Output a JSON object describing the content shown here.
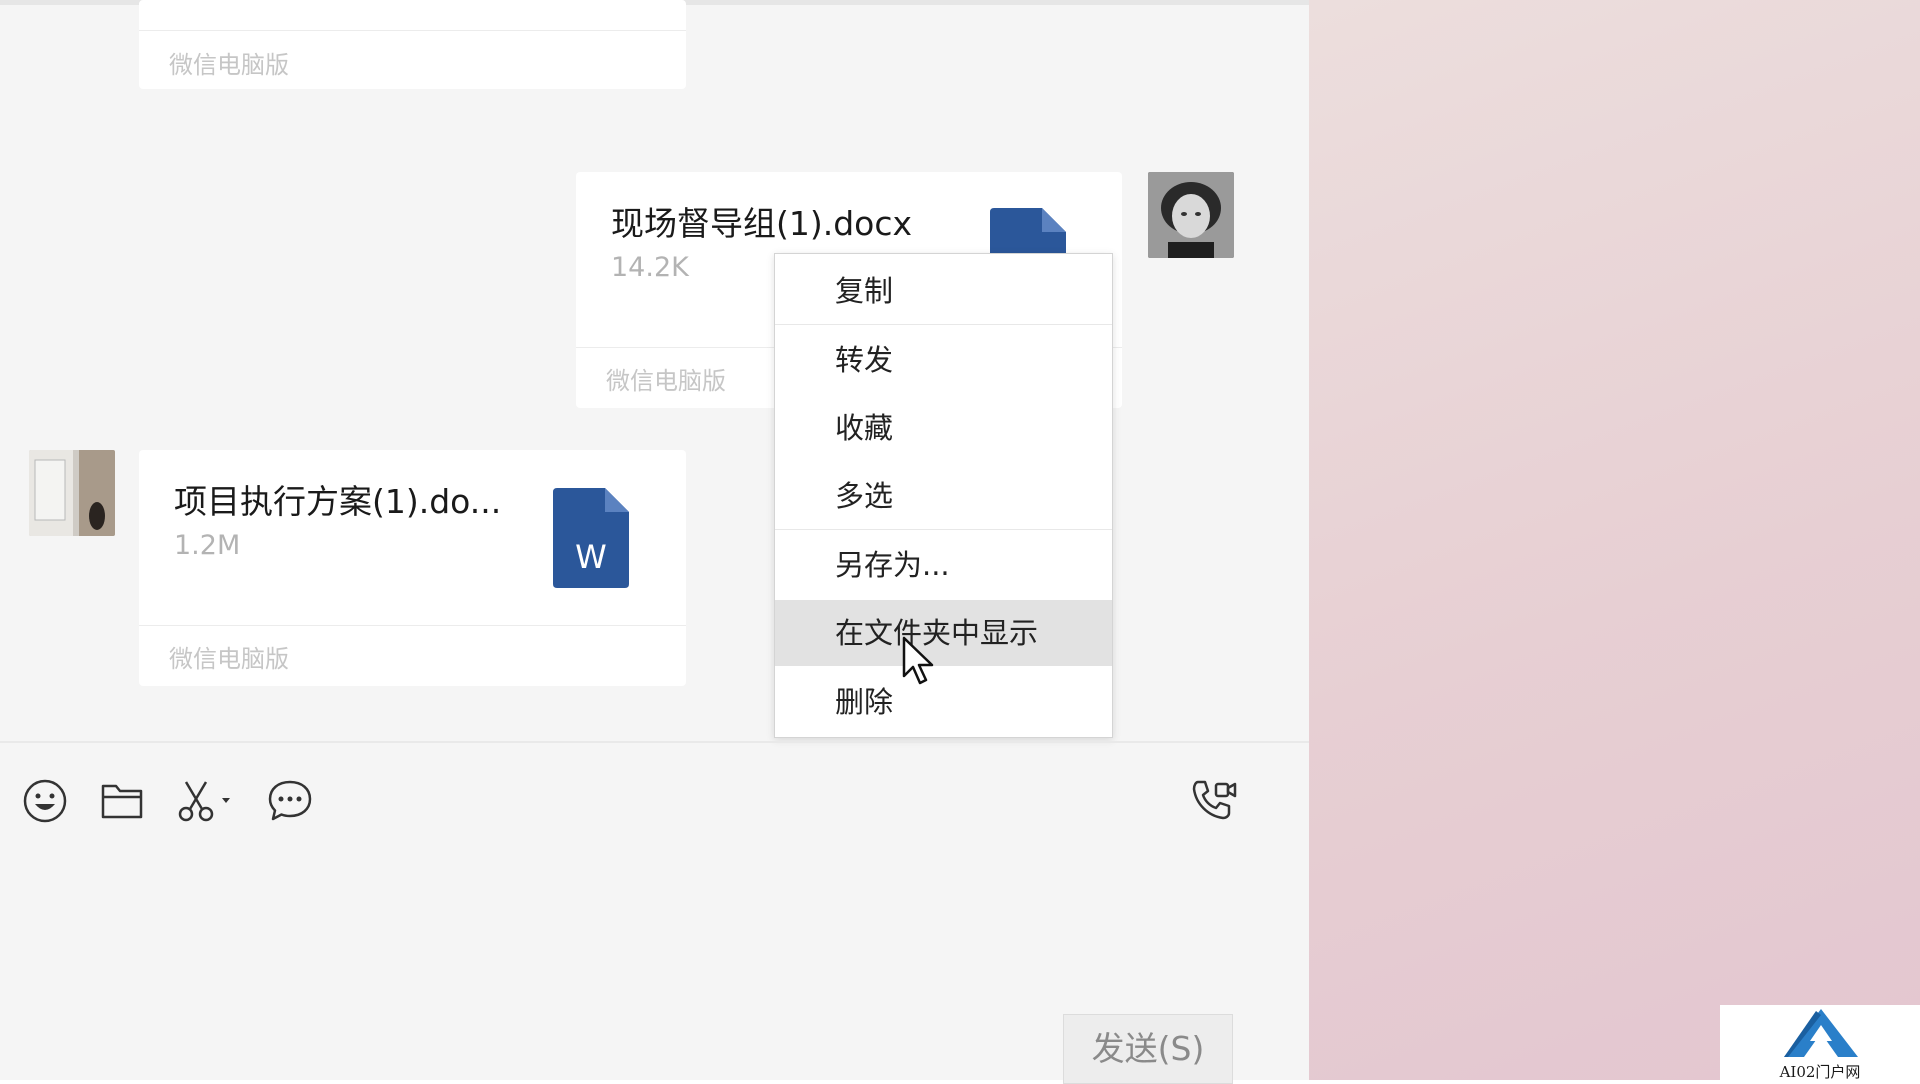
{
  "messages": {
    "prev_partial": {
      "source": "微信电脑版"
    },
    "sent_file": {
      "name": "现场督导组(1).docx",
      "size": "14.2K",
      "source": "微信电脑版"
    },
    "received_file": {
      "name": "项目执行方案(1).do...",
      "size": "1.2M",
      "source": "微信电脑版",
      "icon_letter": "W"
    }
  },
  "context_menu": {
    "items": [
      {
        "label": "复制"
      },
      {
        "label": "转发"
      },
      {
        "label": "收藏"
      },
      {
        "label": "多选"
      },
      {
        "label": "另存为..."
      },
      {
        "label": "在文件夹中显示",
        "highlighted": true
      },
      {
        "label": "删除"
      }
    ]
  },
  "toolbar": {
    "icons": [
      "emoji-icon",
      "folder-icon",
      "scissors-icon",
      "chat-bubble-icon",
      "voice-video-call-icon"
    ]
  },
  "send_button": {
    "label": "发送(S)"
  },
  "watermark": {
    "text": "AI02门户网"
  },
  "colors": {
    "word_blue": "#2b579a",
    "chat_bg": "#f5f5f5",
    "menu_highlight": "#e2e2e2"
  }
}
